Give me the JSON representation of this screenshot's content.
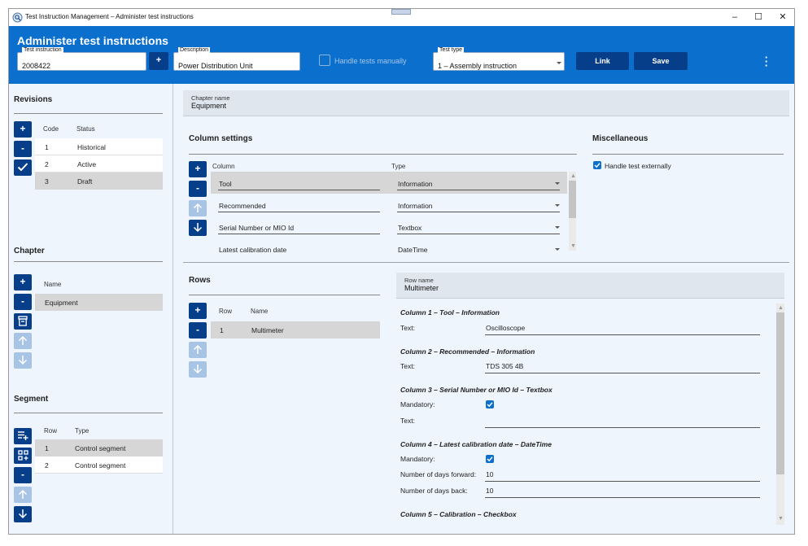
{
  "window": {
    "title": "Test Instruction Management – Administer test instructions"
  },
  "header": {
    "page_title": "Administer test instructions",
    "test_instruction": {
      "label": "Test instruction",
      "value": "2008422"
    },
    "description": {
      "label": "Description",
      "value": "Power Distribution Unit"
    },
    "handle_manually": {
      "label": "Handle tests manually",
      "checked": false
    },
    "test_type": {
      "label": "Test type",
      "value": "1 – Assembly instruction"
    },
    "add_label": "+",
    "link_label": "Link",
    "save_label": "Save"
  },
  "revisions": {
    "title": "Revisions",
    "columns": [
      "Code",
      "Status"
    ],
    "rows": [
      {
        "code": "1",
        "status": "Historical"
      },
      {
        "code": "2",
        "status": "Active"
      },
      {
        "code": "3",
        "status": "Draft"
      }
    ],
    "selected_index": 2
  },
  "chapter": {
    "title": "Chapter",
    "columns": [
      "Name"
    ],
    "rows": [
      {
        "name": "Equipment"
      }
    ]
  },
  "segment": {
    "title": "Segment",
    "columns": [
      "Row",
      "Type"
    ],
    "rows": [
      {
        "row": "1",
        "type": "Control segment"
      },
      {
        "row": "2",
        "type": "Control segment"
      }
    ]
  },
  "chapter_name": {
    "label": "Chapter name",
    "value": "Equipment"
  },
  "column_settings": {
    "title": "Column settings",
    "columns": [
      "Column",
      "Type"
    ],
    "rows": [
      {
        "column": "Tool",
        "type": "Information"
      },
      {
        "column": "Recommended",
        "type": "Information"
      },
      {
        "column": "Serial Number or MIO Id",
        "type": "Textbox"
      },
      {
        "column": "Latest calibration date",
        "type": "DateTime"
      }
    ]
  },
  "miscellaneous": {
    "title": "Miscellaneous",
    "handle_externally": {
      "label": "Handle test externally",
      "checked": true
    }
  },
  "rows_section": {
    "title": "Rows",
    "columns": [
      "Row",
      "Name"
    ],
    "rows": [
      {
        "row": "1",
        "name": "Multimeter"
      }
    ]
  },
  "row_name": {
    "label": "Row name",
    "value": "Multimeter"
  },
  "row_details": {
    "col1": {
      "heading": "Column 1 – Tool – Information",
      "text_label": "Text:",
      "text_value": "Oscilloscope"
    },
    "col2": {
      "heading": "Column 2 – Recommended – Information",
      "text_label": "Text:",
      "text_value": "TDS 305 4B"
    },
    "col3": {
      "heading": "Column 3 – Serial Number or MIO Id – Textbox",
      "mandatory_label": "Mandatory:",
      "mandatory": true,
      "text_label": "Text:",
      "text_value": ""
    },
    "col4": {
      "heading": "Column 4 – Latest calibration date – DateTime",
      "mandatory_label": "Mandatory:",
      "mandatory": true,
      "forward_label": "Number of days forward:",
      "forward_value": "10",
      "back_label": "Number of days back:",
      "back_value": "10"
    },
    "col5": {
      "heading": "Column 5 – Calibration – Checkbox"
    }
  },
  "colors": {
    "header_blue": "#0b6fce",
    "button_navy": "#073e8a",
    "disabled_blue": "#a8c4e4",
    "background": "#eef5fd"
  },
  "icons": [
    "app-icon",
    "minimize-icon",
    "maximize-icon",
    "close-icon",
    "more-vert-icon",
    "plus-icon",
    "minus-icon",
    "check-icon",
    "arrow-up-icon",
    "arrow-down-icon",
    "archive-icon",
    "playlist-add-icon",
    "grid-add-icon",
    "dropdown-caret-icon",
    "checkbox-checked-icon"
  ]
}
